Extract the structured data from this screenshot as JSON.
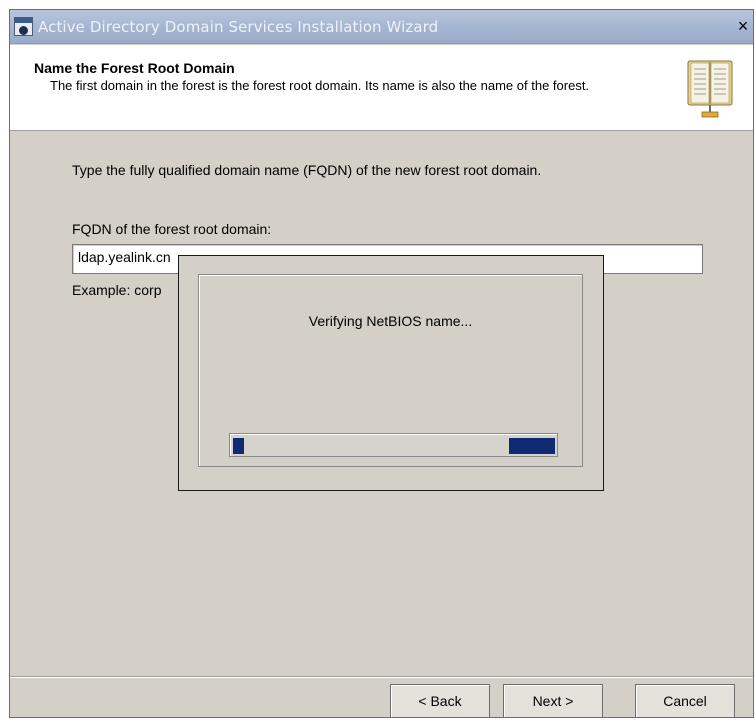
{
  "window": {
    "title": "Active Directory Domain Services Installation Wizard",
    "close_glyph": "×",
    "title_icon": "ad-ds-window-icon"
  },
  "header": {
    "title": "Name the Forest Root Domain",
    "subtitle": "The first domain in the forest is the forest root domain. Its name is also the name of the forest.",
    "icon": "open-book-icon"
  },
  "main": {
    "instruction": "Type the fully qualified domain name (FQDN) of the new forest root domain.",
    "fqdn_label": "FQDN of the forest root domain:",
    "fqdn_value": "ldap.yealink.cn",
    "example_text": "Example: corp"
  },
  "progress_dialog": {
    "message": "Verifying NetBIOS name...",
    "state": "indeterminate marquee"
  },
  "footer": {
    "back_label": "< Back",
    "next_label": "Next >",
    "cancel_label": "Cancel"
  },
  "colors": {
    "title_bar": "#a4b5d0",
    "dialog_bg": "#d4d0c8",
    "progress_fill": "#0f2b73"
  }
}
